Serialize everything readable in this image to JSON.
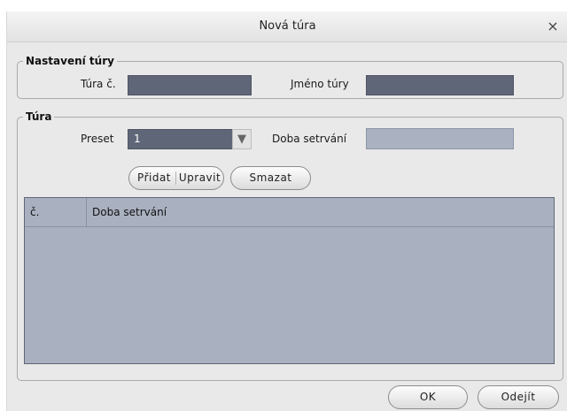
{
  "dialog": {
    "title": "Nová túra",
    "close_glyph": "×"
  },
  "tour_settings": {
    "legend": "Nastavení túry",
    "tour_no_label": "Túra č.",
    "tour_no_value": "",
    "tour_name_label": "Jméno túry",
    "tour_name_value": ""
  },
  "tour": {
    "legend": "Túra",
    "preset_label": "Preset",
    "preset_value": "1",
    "dwell_label": "Doba setrvání",
    "dwell_value": "",
    "add_label": "Přidat",
    "edit_label": "Upravit",
    "delete_label": "Smazat"
  },
  "table": {
    "columns": [
      "č.",
      "Doba setrvání"
    ],
    "rows": []
  },
  "footer": {
    "ok_label": "OK",
    "exit_label": "Odejít"
  },
  "colors": {
    "dark_field": "#5f6677",
    "light_field": "#aab2c2",
    "table_bg": "#a9b1c0"
  },
  "icons": {
    "close": "close-icon",
    "dropdown": "triangle-down-icon"
  }
}
